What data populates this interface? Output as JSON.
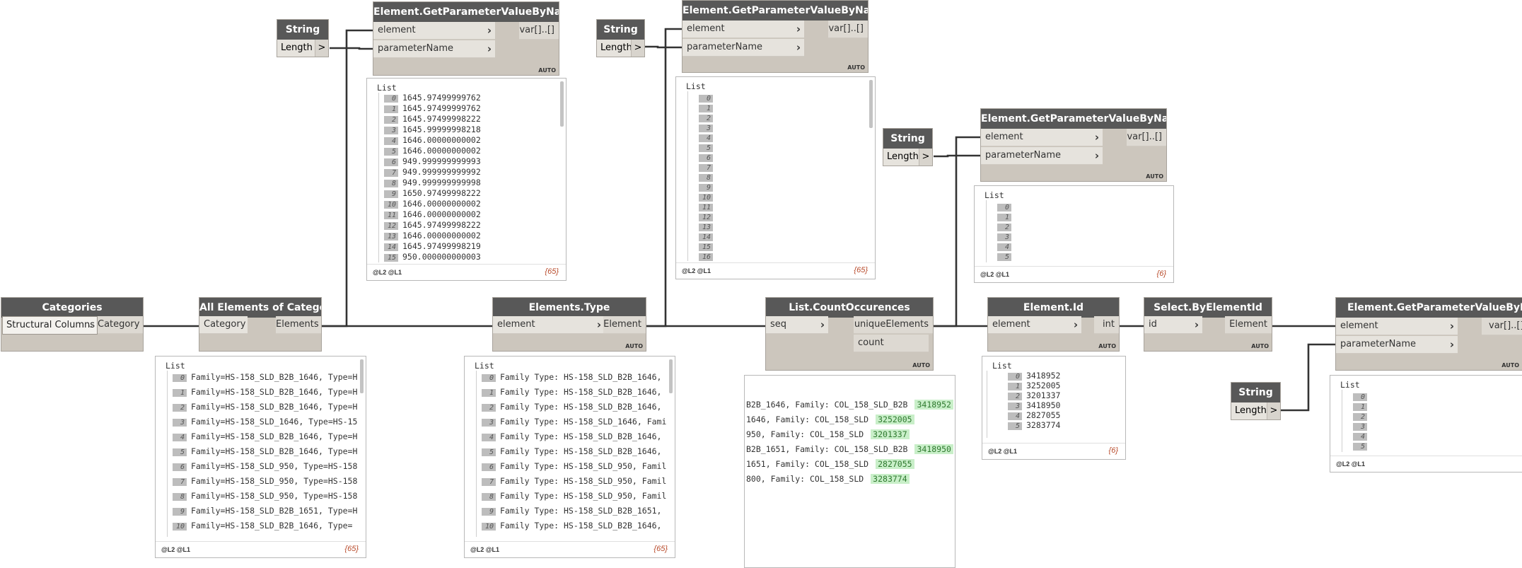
{
  "nodes": {
    "categories": {
      "title": "Categories",
      "selected": "Structural Columns",
      "output": "Category"
    },
    "all_elements": {
      "title": "All Elements of Category",
      "input": "Category",
      "output": "Elements"
    },
    "elements_type": {
      "title": "Elements.Type",
      "input": "element",
      "output": "Element",
      "lacing": "AUTO"
    },
    "count_occ": {
      "title": "List.CountOccurences",
      "input": "seq",
      "output1": "uniqueElements",
      "output2": "count",
      "lacing": "AUTO"
    },
    "element_id": {
      "title": "Element.Id",
      "input": "element",
      "output": "int",
      "lacing": "AUTO"
    },
    "select_by_id": {
      "title": "Select.ByElementId",
      "input": "id",
      "output": "Element",
      "lacing": "AUTO"
    },
    "getparam1": {
      "title": "Element.GetParameterValueByName",
      "in1": "element",
      "in2": "parameterName",
      "output": "var[]..[]",
      "lacing": "AUTO"
    },
    "getparam2": {
      "title": "Element.GetParameterValueByName",
      "in1": "element",
      "in2": "parameterName",
      "output": "var[]..[]",
      "lacing": "AUTO"
    },
    "getparam3": {
      "title": "Element.GetParameterValueByName",
      "in1": "element",
      "in2": "parameterName",
      "output": "var[]..[]",
      "lacing": "AUTO"
    },
    "getparam4": {
      "title": "Element.GetParameterValueByName",
      "in1": "element",
      "in2": "parameterName",
      "output": "var[]..[]",
      "lacing": "AUTO"
    },
    "string1": {
      "title": "String",
      "port": "Length",
      "arrow": ">"
    },
    "string2": {
      "title": "String",
      "port": "Length",
      "arrow": ">"
    },
    "string3": {
      "title": "String",
      "port": "Length",
      "arrow": ">"
    },
    "string4": {
      "title": "String",
      "port": "Length",
      "arrow": ">"
    }
  },
  "previews": {
    "all_elements": {
      "title": "List",
      "levels": "@L2 @L1",
      "count": "{65}",
      "rows": [
        {
          "i": "0",
          "v": "Family=HS-158_SLD_B2B_1646, Type=H"
        },
        {
          "i": "1",
          "v": "Family=HS-158_SLD_B2B_1646, Type=H"
        },
        {
          "i": "2",
          "v": "Family=HS-158_SLD_B2B_1646, Type=H"
        },
        {
          "i": "3",
          "v": "Family=HS-158_SLD_1646, Type=HS-15"
        },
        {
          "i": "4",
          "v": "Family=HS-158_SLD_B2B_1646, Type=H"
        },
        {
          "i": "5",
          "v": "Family=HS-158_SLD_B2B_1646, Type=H"
        },
        {
          "i": "6",
          "v": "Family=HS-158_SLD_950, Type=HS-158"
        },
        {
          "i": "7",
          "v": "Family=HS-158_SLD_950, Type=HS-158"
        },
        {
          "i": "8",
          "v": "Family=HS-158_SLD_950, Type=HS-158"
        },
        {
          "i": "9",
          "v": "Family=HS-158_SLD_B2B_1651, Type=H"
        },
        {
          "i": "10",
          "v": "Family=HS-158_SLD_B2B_1646, Type="
        }
      ]
    },
    "elements_type": {
      "title": "List",
      "levels": "@L2 @L1",
      "count": "{65}",
      "rows": [
        {
          "i": "0",
          "v": "Family Type: HS-158_SLD_B2B_1646,"
        },
        {
          "i": "1",
          "v": "Family Type: HS-158_SLD_B2B_1646,"
        },
        {
          "i": "2",
          "v": "Family Type: HS-158_SLD_B2B_1646,"
        },
        {
          "i": "3",
          "v": "Family Type: HS-158_SLD_1646, Fami"
        },
        {
          "i": "4",
          "v": "Family Type: HS-158_SLD_B2B_1646,"
        },
        {
          "i": "5",
          "v": "Family Type: HS-158_SLD_B2B_1646,"
        },
        {
          "i": "6",
          "v": "Family Type: HS-158_SLD_950, Famil"
        },
        {
          "i": "7",
          "v": "Family Type: HS-158_SLD_950, Famil"
        },
        {
          "i": "8",
          "v": "Family Type: HS-158_SLD_950, Famil"
        },
        {
          "i": "9",
          "v": "Family Type: HS-158_SLD_B2B_1651,"
        },
        {
          "i": "10",
          "v": "Family Type: HS-158_SLD_B2B_1646,"
        }
      ]
    },
    "count_occ": {
      "rows": [
        {
          "v": "B2B_1646, Family: COL_158_SLD_B2B",
          "id": "3418952"
        },
        {
          "v": "1646, Family: COL_158_SLD",
          "id": "3252005"
        },
        {
          "v": "950, Family: COL_158_SLD",
          "id": "3201337"
        },
        {
          "v": "B2B_1651, Family: COL_158_SLD_B2B",
          "id": "3418950"
        },
        {
          "v": "1651, Family: COL_158_SLD",
          "id": "2827055"
        },
        {
          "v": "800, Family: COL_158_SLD",
          "id": "3283774"
        }
      ]
    },
    "element_id": {
      "title": "List",
      "levels": "@L2 @L1",
      "count": "{6}",
      "rows": [
        {
          "i": "0",
          "v": "3418952"
        },
        {
          "i": "1",
          "v": "3252005"
        },
        {
          "i": "2",
          "v": "3201337"
        },
        {
          "i": "3",
          "v": "3418950"
        },
        {
          "i": "4",
          "v": "2827055"
        },
        {
          "i": "5",
          "v": "3283774"
        }
      ]
    },
    "getparam1": {
      "title": "List",
      "levels": "@L2 @L1",
      "count": "{65}",
      "rows": [
        {
          "i": "0",
          "v": "1645.97499999762"
        },
        {
          "i": "1",
          "v": "1645.97499999762"
        },
        {
          "i": "2",
          "v": "1645.97499998222"
        },
        {
          "i": "3",
          "v": "1645.99999998218"
        },
        {
          "i": "4",
          "v": "1646.00000000002"
        },
        {
          "i": "5",
          "v": "1646.00000000002"
        },
        {
          "i": "6",
          "v": "949.999999999993"
        },
        {
          "i": "7",
          "v": "949.999999999992"
        },
        {
          "i": "8",
          "v": "949.999999999998"
        },
        {
          "i": "9",
          "v": "1650.97499998222"
        },
        {
          "i": "10",
          "v": "1646.00000000002"
        },
        {
          "i": "11",
          "v": "1646.00000000002"
        },
        {
          "i": "12",
          "v": "1645.97499998222"
        },
        {
          "i": "13",
          "v": "1646.00000000002"
        },
        {
          "i": "14",
          "v": "1645.97499998219"
        },
        {
          "i": "15",
          "v": "950.000000000003"
        }
      ]
    },
    "getparam2": {
      "title": "List",
      "levels": "@L2 @L1",
      "count": "{65}",
      "rows": [
        {
          "i": "0",
          "v": ""
        },
        {
          "i": "1",
          "v": ""
        },
        {
          "i": "2",
          "v": ""
        },
        {
          "i": "3",
          "v": ""
        },
        {
          "i": "4",
          "v": ""
        },
        {
          "i": "5",
          "v": ""
        },
        {
          "i": "6",
          "v": ""
        },
        {
          "i": "7",
          "v": ""
        },
        {
          "i": "8",
          "v": ""
        },
        {
          "i": "9",
          "v": ""
        },
        {
          "i": "10",
          "v": ""
        },
        {
          "i": "11",
          "v": ""
        },
        {
          "i": "12",
          "v": ""
        },
        {
          "i": "13",
          "v": ""
        },
        {
          "i": "14",
          "v": ""
        },
        {
          "i": "15",
          "v": ""
        },
        {
          "i": "16",
          "v": ""
        }
      ]
    },
    "getparam3": {
      "title": "List",
      "levels": "@L2 @L1",
      "count": "{6}",
      "rows": [
        {
          "i": "0",
          "v": ""
        },
        {
          "i": "1",
          "v": ""
        },
        {
          "i": "2",
          "v": ""
        },
        {
          "i": "3",
          "v": ""
        },
        {
          "i": "4",
          "v": ""
        },
        {
          "i": "5",
          "v": ""
        }
      ]
    },
    "getparam4": {
      "title": "List",
      "levels": "@L2 @L1",
      "count": "",
      "rows": [
        {
          "i": "0",
          "v": ""
        },
        {
          "i": "1",
          "v": ""
        },
        {
          "i": "2",
          "v": ""
        },
        {
          "i": "3",
          "v": ""
        },
        {
          "i": "4",
          "v": ""
        },
        {
          "i": "5",
          "v": ""
        }
      ]
    }
  }
}
